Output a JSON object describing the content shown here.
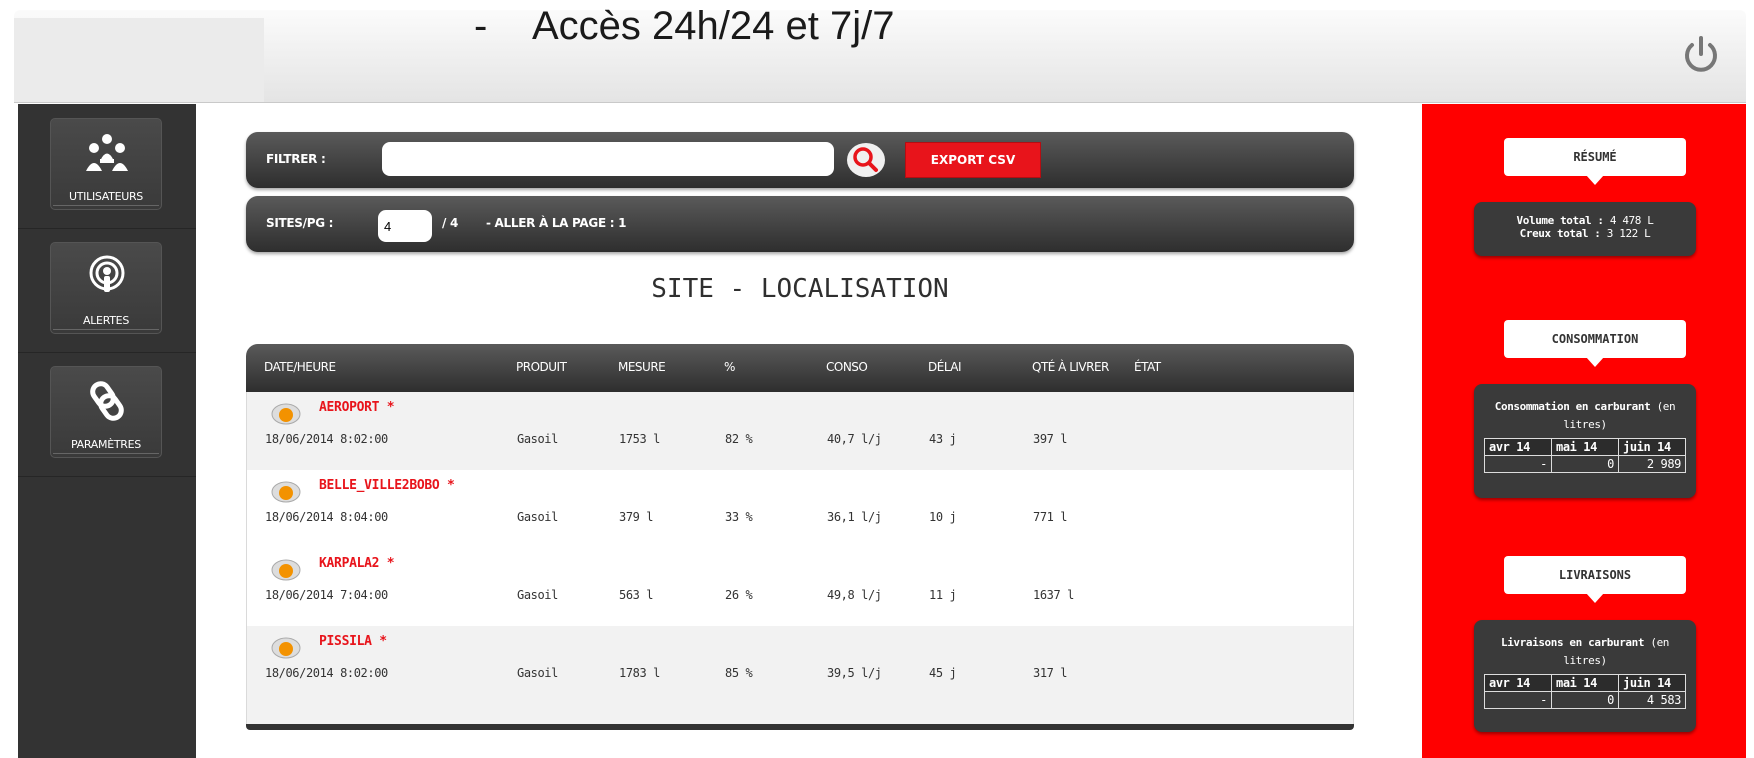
{
  "header": {
    "slide_dash": "-",
    "slide_text": "Accès 24h/24 et 7j/7",
    "power_icon": "power-icon"
  },
  "sidebar": {
    "items": [
      {
        "label": "UTILISATEURS",
        "icon": "users-icon"
      },
      {
        "label": "ALERTES",
        "icon": "broadcast-icon"
      },
      {
        "label": "PARAMÈTRES",
        "icon": "link-icon"
      }
    ]
  },
  "filter": {
    "label": "FILTRER :",
    "value": "",
    "placeholder": "",
    "search_icon": "search-icon",
    "export_label": "EXPORT CSV"
  },
  "paging": {
    "label": "SITES/PG :",
    "value": "4",
    "total": "/ 4",
    "goto": "- ALLER À LA PAGE : 1"
  },
  "title": "SITE - LOCALISATION",
  "table": {
    "columns": [
      "DATE/HEURE",
      "PRODUIT",
      "MESURE",
      "%",
      "CONSO",
      "DÉLAI",
      "QTÉ À LIVRER",
      "ÉTAT"
    ],
    "rows": [
      {
        "site": "AEROPORT *",
        "datetime": "18/06/2014 8:02:00",
        "produit": "Gasoil",
        "mesure": "1753 l",
        "percent": "82 %",
        "conso": "40,7 l/j",
        "delai": "43 j",
        "qte": "397 l"
      },
      {
        "site": "BELLE_VILLE2BOBO *",
        "datetime": "18/06/2014 8:04:00",
        "produit": "Gasoil",
        "mesure": "379 l",
        "percent": "33 %",
        "conso": "36,1 l/j",
        "delai": "10 j",
        "qte": "771 l"
      },
      {
        "site": "KARPALA2 *",
        "datetime": "18/06/2014 7:04:00",
        "produit": "Gasoil",
        "mesure": "563 l",
        "percent": "26 %",
        "conso": "49,8 l/j",
        "delai": "11 j",
        "qte": "1637 l"
      },
      {
        "site": "PISSILA *",
        "datetime": "18/06/2014 8:02:00",
        "produit": "Gasoil",
        "mesure": "1783 l",
        "percent": "85 %",
        "conso": "39,5 l/j",
        "delai": "45 j",
        "qte": "317 l"
      }
    ]
  },
  "summary": {
    "resume_tab": "RÉSUMÉ",
    "volume_label": "Volume total :",
    "volume_value": "4 478 L",
    "creux_label": "Creux total :",
    "creux_value": "3 122 L",
    "conso_tab": "CONSOMMATION",
    "conso_title_bold": "Consommation en carburant",
    "conso_title_unit": "(en litres)",
    "conso_months": [
      "avr 14",
      "mai 14",
      "juin 14"
    ],
    "conso_values": [
      "-",
      "0",
      "2 989"
    ],
    "livr_tab": "LIVRAISONS",
    "livr_title_bold": "Livraisons en carburant",
    "livr_title_unit": "(en litres)",
    "livr_months": [
      "avr 14",
      "mai 14",
      "juin 14"
    ],
    "livr_values": [
      "-",
      "0",
      "4 583"
    ]
  },
  "colors": {
    "accent_red": "#e8141b",
    "panel_red": "#ff0000",
    "dark": "#333333"
  }
}
